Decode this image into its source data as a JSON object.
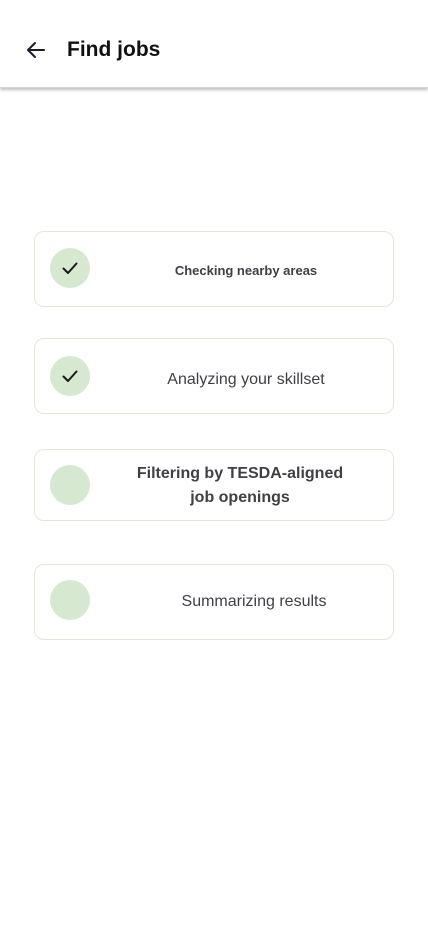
{
  "header": {
    "title": "Find jobs",
    "back_icon": "arrow-left-icon"
  },
  "colors": {
    "step_circle": "#d6e8cf",
    "card_border": "#e3e8d6",
    "check": "#1a1a1a"
  },
  "steps": [
    {
      "label": "Checking nearby areas",
      "status": "complete",
      "icon": "check-icon"
    },
    {
      "label": "Analyzing your skillset",
      "status": "complete",
      "icon": "check-icon"
    },
    {
      "label_line1": "Filtering by TESDA-aligned",
      "label_line2": "job openings",
      "status": "pending"
    },
    {
      "label": "Summarizing results",
      "status": "pending"
    }
  ]
}
